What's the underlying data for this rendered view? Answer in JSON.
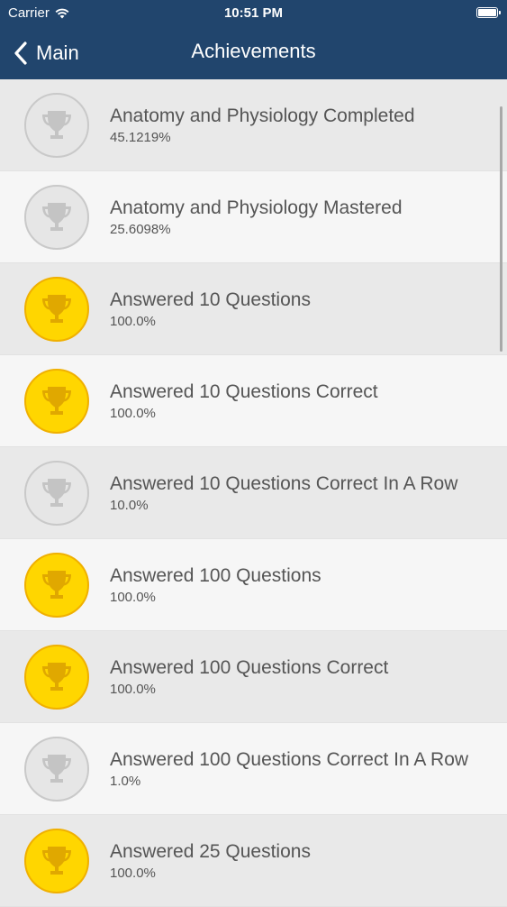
{
  "status_bar": {
    "carrier": "Carrier",
    "time": "10:51 PM"
  },
  "nav": {
    "back_label": "Main",
    "title": "Achievements"
  },
  "colors": {
    "nav_background": "#21456d",
    "gold_badge": "#ffd600",
    "silver_badge": "#e6e6e6",
    "text": "#555555"
  },
  "achievements": [
    {
      "title": "Anatomy and Physiology Completed",
      "percent": "45.1219%",
      "earned": false,
      "icon": "trophy-icon"
    },
    {
      "title": "Anatomy and Physiology Mastered",
      "percent": "25.6098%",
      "earned": false,
      "icon": "trophy-icon"
    },
    {
      "title": "Answered 10 Questions",
      "percent": "100.0%",
      "earned": true,
      "icon": "trophy-icon"
    },
    {
      "title": "Answered 10 Questions Correct",
      "percent": "100.0%",
      "earned": true,
      "icon": "trophy-icon"
    },
    {
      "title": "Answered 10 Questions Correct In A Row",
      "percent": "10.0%",
      "earned": false,
      "icon": "trophy-icon"
    },
    {
      "title": "Answered 100 Questions",
      "percent": "100.0%",
      "earned": true,
      "icon": "trophy-icon"
    },
    {
      "title": "Answered 100 Questions Correct",
      "percent": "100.0%",
      "earned": true,
      "icon": "trophy-icon"
    },
    {
      "title": "Answered 100 Questions Correct In A Row",
      "percent": "1.0%",
      "earned": false,
      "icon": "trophy-icon"
    },
    {
      "title": "Answered 25 Questions",
      "percent": "100.0%",
      "earned": true,
      "icon": "trophy-icon"
    }
  ]
}
